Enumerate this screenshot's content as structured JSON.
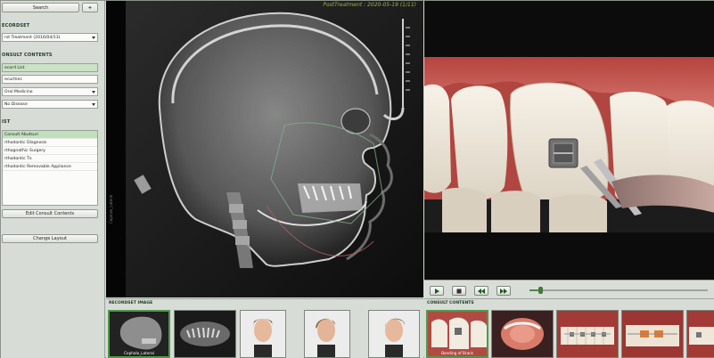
{
  "left_panel": {
    "search_label": "Search",
    "add_label": "+",
    "record_set_title": "ECORDSET",
    "record_set_value": "rst Treatment (2016/04/13)",
    "consult_contents_title": "ONSULT CONTENTS",
    "search_field_value": "ecord List",
    "text_field_value": "ecurities",
    "category_value": "Oral Medicine",
    "disease_value": "No Disease",
    "list_title": "IST",
    "list_items": [
      "Consult Abutsuri",
      "rthodontic Diagnosis",
      "rthognathic Surgery",
      "rthodontic Tx",
      "rthodontic Removable Appliance"
    ],
    "edit_button": "Edit Consult Contents",
    "change_layout_button": "Change Layout"
  },
  "xray": {
    "title": "PostTreatment : 2020-05-19 (1/11)",
    "side_label": "Cephalo_Lateral"
  },
  "video": {
    "progress_fraction": 0.06
  },
  "record_image": {
    "title": "RECORDSET IMAGE",
    "thumbs": [
      {
        "label": "Cephalo_Lateral",
        "active": true
      },
      {
        "label": "",
        "active": false
      },
      {
        "label": "",
        "active": false
      },
      {
        "label": "",
        "active": false
      },
      {
        "label": "",
        "active": false
      },
      {
        "label": "",
        "active": false
      }
    ]
  },
  "consult_contents": {
    "title": "CONSULT CONTENTS",
    "thumbs": [
      {
        "label": "Bonding of Brack",
        "active": true
      },
      {
        "label": "",
        "active": false
      },
      {
        "label": "",
        "active": false
      },
      {
        "label": "",
        "active": false
      },
      {
        "label": "",
        "active": false
      }
    ]
  },
  "colors": {
    "accent": "#4d9a4a",
    "panel_bg": "#d7dcd6",
    "selection": "#bfe0bb"
  }
}
